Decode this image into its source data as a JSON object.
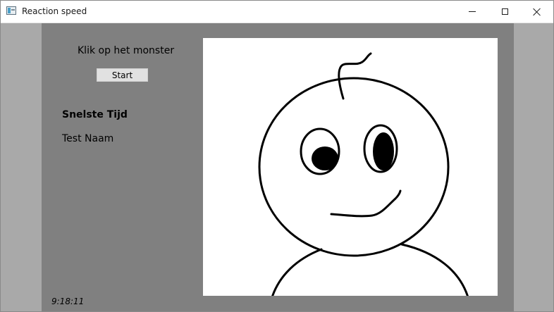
{
  "window": {
    "title": "Reaction speed",
    "icon": "app-window-icon"
  },
  "controls": {
    "minimize": "minimize-icon",
    "maximize": "maximize-icon",
    "close": "close-icon"
  },
  "panel": {
    "instruction": "Klik op het monster",
    "start_label": "Start",
    "fastest_label": "Snelste Tijd",
    "fastest_name": "Test Naam",
    "clock": "9:18:11"
  },
  "colors": {
    "outer_background": "#a9a9a9",
    "panel_background": "#808080",
    "canvas_background": "#ffffff",
    "drawing_stroke": "#000000"
  }
}
